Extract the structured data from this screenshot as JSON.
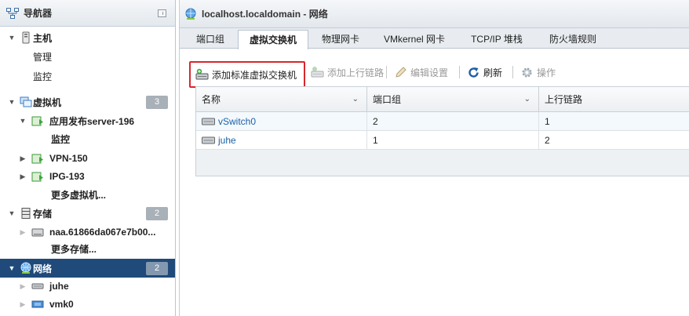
{
  "navigator": {
    "title": "导航器",
    "items": [
      {
        "label": "主机"
      },
      {
        "label": "管理"
      },
      {
        "label": "监控"
      },
      {
        "label": "虚拟机",
        "badge": "3"
      },
      {
        "label": "应用发布server-196"
      },
      {
        "label": "监控"
      },
      {
        "label": "VPN-150"
      },
      {
        "label": "IPG-193"
      },
      {
        "label": "更多虚拟机..."
      },
      {
        "label": "存储",
        "badge": "2"
      },
      {
        "label": "naa.61866da067e7b00..."
      },
      {
        "label": "更多存储..."
      },
      {
        "label": "网络",
        "badge": "2"
      },
      {
        "label": "juhe"
      },
      {
        "label": "vmk0"
      }
    ]
  },
  "main": {
    "title": "localhost.localdomain - 网络",
    "tabs": [
      {
        "label": "端口组"
      },
      {
        "label": "虚拟交换机"
      },
      {
        "label": "物理网卡"
      },
      {
        "label": "VMkernel 网卡"
      },
      {
        "label": "TCP/IP 堆栈"
      },
      {
        "label": "防火墙规则"
      }
    ],
    "toolbar": {
      "add_vswitch": "添加标准虚拟交换机",
      "add_uplink": "添加上行链路",
      "edit_settings": "编辑设置",
      "refresh": "刷新",
      "actions": "操作"
    },
    "table": {
      "columns": [
        "名称",
        "端口组",
        "上行链路"
      ],
      "rows": [
        {
          "name": "vSwitch0",
          "port_groups": "2",
          "uplinks": "1"
        },
        {
          "name": "juhe",
          "port_groups": "1",
          "uplinks": "2"
        }
      ]
    }
  },
  "colors": {
    "selected_nav": "#1f4a7a",
    "highlight_box": "#d9262c",
    "link": "#1a61a8"
  }
}
